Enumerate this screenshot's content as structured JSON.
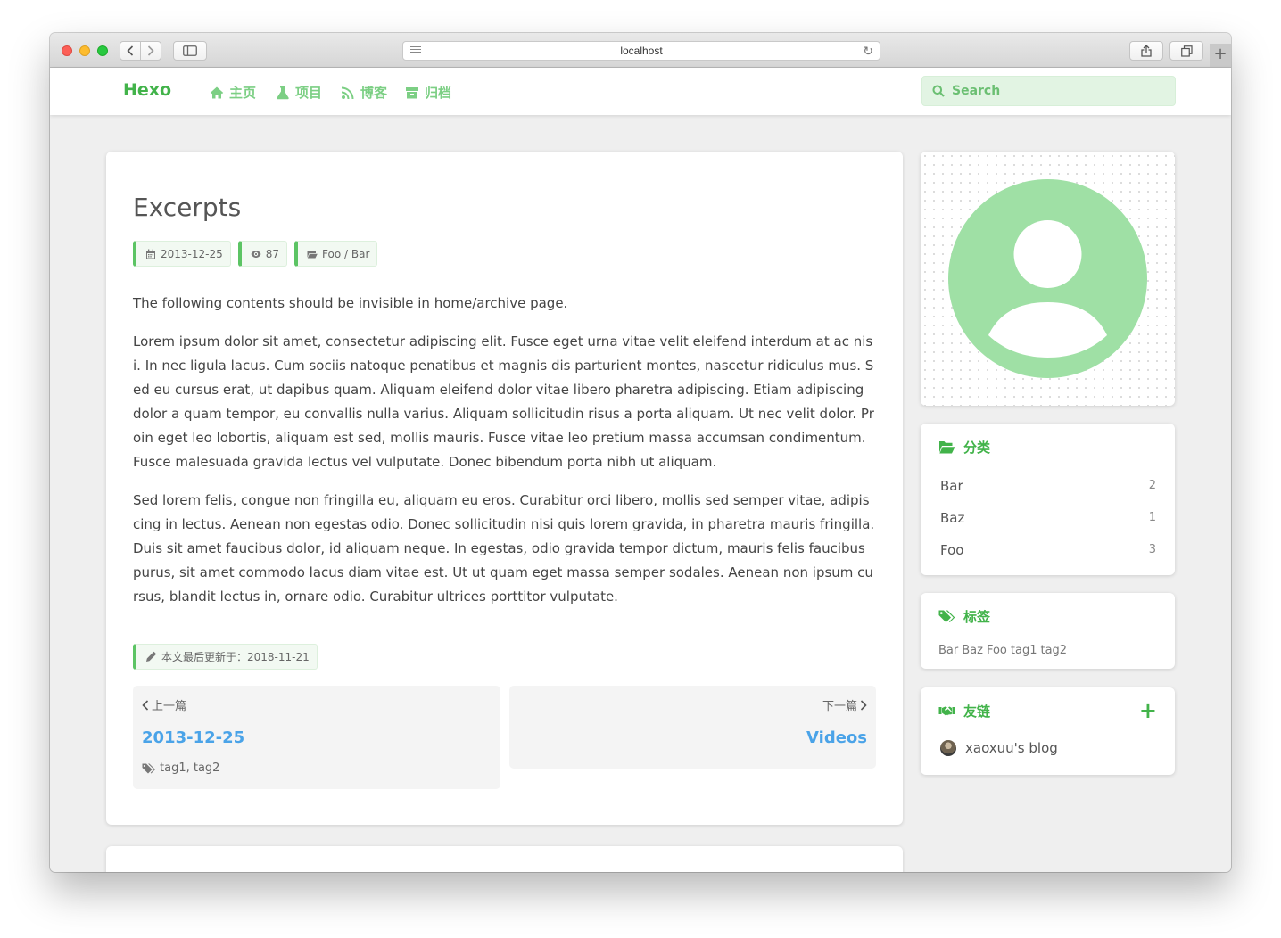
{
  "browser": {
    "url": "localhost"
  },
  "nav": {
    "brand": "Hexo",
    "items": [
      {
        "label": "主页",
        "icon": "home-icon"
      },
      {
        "label": "项目",
        "icon": "flask-icon"
      },
      {
        "label": "博客",
        "icon": "rss-icon"
      },
      {
        "label": "归档",
        "icon": "archive-icon"
      }
    ],
    "search_label": "Search"
  },
  "post": {
    "title": "Excerpts",
    "date": "2013-12-25",
    "views": "87",
    "category": "Foo / Bar",
    "paragraphs": [
      "The following contents should be invisible in home/archive page.",
      "Lorem ipsum dolor sit amet, consectetur adipiscing elit. Fusce eget urna vitae velit eleifend interdum at ac nisi. In nec ligula lacus. Cum sociis natoque penatibus et magnis dis parturient montes, nascetur ridiculus mus. Sed eu cursus erat, ut dapibus quam. Aliquam eleifend dolor vitae libero pharetra adipiscing. Etiam adipiscing dolor a quam tempor, eu convallis nulla varius. Aliquam sollicitudin risus a porta aliquam. Ut nec velit dolor. Proin eget leo lobortis, aliquam est sed, mollis mauris. Fusce vitae leo pretium massa accumsan condimentum. Fusce malesuada gravida lectus vel vulputate. Donec bibendum porta nibh ut aliquam.",
      "Sed lorem felis, congue non fringilla eu, aliquam eu eros. Curabitur orci libero, mollis sed semper vitae, adipiscing in lectus. Aenean non egestas odio. Donec sollicitudin nisi quis lorem gravida, in pharetra mauris fringilla. Duis sit amet faucibus dolor, id aliquam neque. In egestas, odio gravida tempor dictum, mauris felis faucibus purus, sit amet commodo lacus diam vitae est. Ut ut quam eget massa semper sodales. Aenean non ipsum cursus, blandit lectus in, ornare odio. Curabitur ultrices porttitor vulputate."
    ],
    "updated": "本文最后更新于：2018-11-21",
    "prev": {
      "label": "上一篇",
      "title": "2013-12-25",
      "tags": "tag1, tag2"
    },
    "next": {
      "label": "下一篇",
      "title": "Videos"
    }
  },
  "sidebar": {
    "categories": {
      "title": "分类",
      "items": [
        {
          "name": "Bar",
          "count": "2"
        },
        {
          "name": "Baz",
          "count": "1"
        },
        {
          "name": "Foo",
          "count": "3"
        }
      ]
    },
    "tags": {
      "title": "标签",
      "items": [
        "Bar",
        "Baz",
        "Foo",
        "tag1",
        "tag2"
      ]
    },
    "links": {
      "title": "友链",
      "add": "+",
      "items": [
        {
          "name": "xaoxuu's blog"
        }
      ]
    }
  },
  "colors": {
    "accent": "#42b34a",
    "accent_light": "#7ccf84",
    "link": "#4aa3e8",
    "avatar": "#9fe0a5"
  }
}
